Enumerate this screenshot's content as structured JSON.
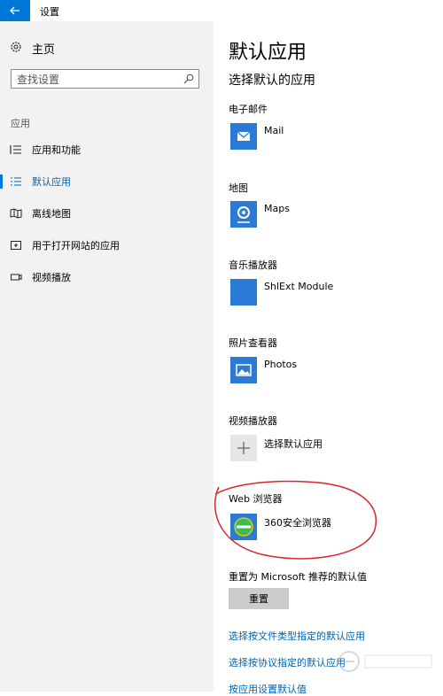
{
  "window": {
    "title": "设置",
    "back_icon": "arrow-left-icon",
    "accent": "#0078d7"
  },
  "sidebar": {
    "home_label": "主页",
    "search_placeholder": "查找设置",
    "section_label": "应用",
    "items": [
      {
        "label": "应用和功能",
        "icon": "list-icon",
        "active": false
      },
      {
        "label": "默认应用",
        "icon": "default-apps-icon",
        "active": true
      },
      {
        "label": "离线地图",
        "icon": "map-icon",
        "active": false
      },
      {
        "label": "用于打开网站的应用",
        "icon": "open-window-icon",
        "active": false
      },
      {
        "label": "视频播放",
        "icon": "video-icon",
        "active": false
      }
    ]
  },
  "main": {
    "title": "默认应用",
    "subtitle": "选择默认的应用",
    "categories": [
      {
        "label": "电子邮件",
        "app": "Mail"
      },
      {
        "label": "地图",
        "app": "Maps"
      },
      {
        "label": "音乐播放器",
        "app": "ShlExt Module"
      },
      {
        "label": "照片查看器",
        "app": "Photos"
      },
      {
        "label": "视频播放器",
        "app": "选择默认应用"
      },
      {
        "label": "Web 浏览器",
        "app": "360安全浏览器"
      }
    ],
    "reset_label": "重置为 Microsoft 推荐的默认值",
    "reset_button": "重置",
    "links": [
      "选择按文件类型指定的默认应用",
      "选择按协议指定的默认应用",
      "按应用设置默认值"
    ]
  },
  "annotation_color": "#d9262e"
}
